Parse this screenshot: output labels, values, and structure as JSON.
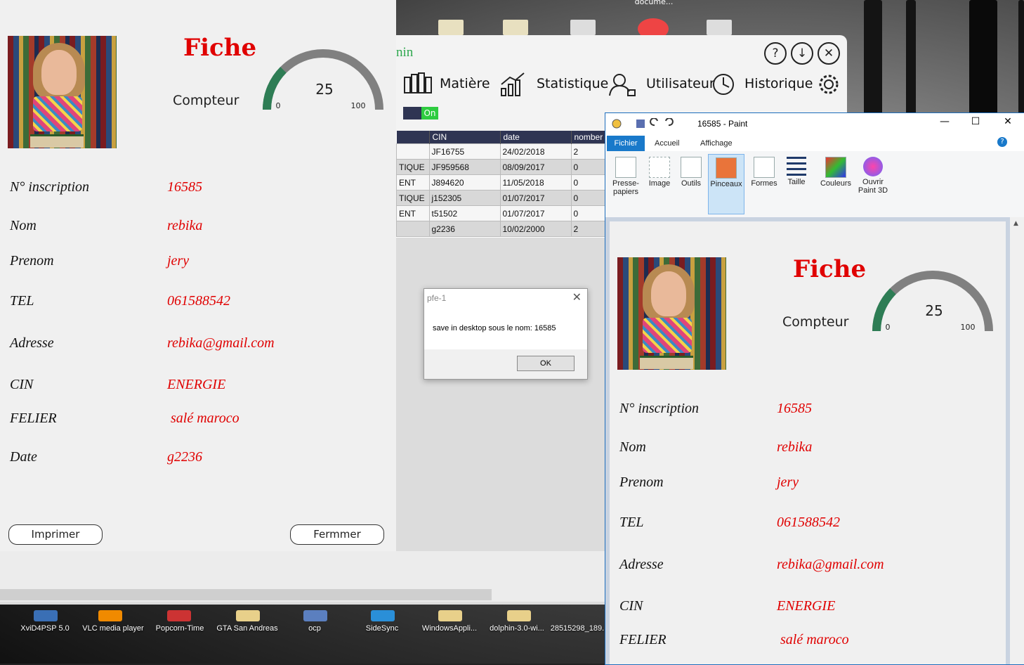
{
  "desktop": {
    "top_icon_label": "docume...",
    "taskbar_icons": [
      "XviD4PSP 5.0",
      "VLC media player",
      "Popcorn-Time",
      "GTA San Andreas",
      "ocp",
      "SideSync",
      "WindowsAppli...",
      "dolphin-3.0-wi...",
      "28515298_189..."
    ]
  },
  "admin_window": {
    "title_fragment": "nin",
    "header_buttons": [
      "?",
      "↓",
      "✕"
    ],
    "menu": [
      "Matière",
      "Statistique",
      "Utilisateur",
      "Historique"
    ],
    "toggle_label": "On",
    "table": {
      "columns": [
        "",
        "CIN",
        "date",
        "nomber"
      ],
      "rows": [
        [
          "",
          "JF16755",
          "24/02/2018",
          "2"
        ],
        [
          "TIQUE",
          "JF959568",
          "08/09/2017",
          "0"
        ],
        [
          "ENT",
          "J894620",
          "11/05/2018",
          "0"
        ],
        [
          "TIQUE",
          "j152305",
          "01/07/2017",
          "0"
        ],
        [
          "ENT",
          "t51502",
          "01/07/2017",
          "0"
        ],
        [
          "",
          "g2236",
          "10/02/2000",
          "2"
        ]
      ]
    }
  },
  "dialog": {
    "title": "pfe-1",
    "message": "save in desktop sous le nom:   16585",
    "ok": "OK",
    "close": "✕"
  },
  "fiche": {
    "title": "Fiche",
    "compteur_label": "Compteur",
    "gauge": {
      "value": 25,
      "min_label": "0",
      "max_label": "100",
      "fill_fraction": 0.25,
      "color_fill": "#2e7d55",
      "color_track": "#808080"
    },
    "fields": [
      {
        "label": "N° inscription",
        "value": "16585"
      },
      {
        "label": "Nom",
        "value": "rebika"
      },
      {
        "label": "Prenom",
        "value": "jery"
      },
      {
        "label": "TEL",
        "value": "061588542"
      },
      {
        "label": "Adresse",
        "value": "rebika@gmail.com"
      },
      {
        "label": "CIN",
        "value": "ENERGIE"
      },
      {
        "label": "FELIER",
        "value": " salé maroco"
      },
      {
        "label": "Date",
        "value": "g2236"
      }
    ],
    "buttons": {
      "print": "Imprimer",
      "close": "Fermmer"
    }
  },
  "paint": {
    "title": "16585 - Paint",
    "window_controls": [
      "—",
      "☐",
      "✕"
    ],
    "tabs": [
      "Fichier",
      "Accueil",
      "Affichage"
    ],
    "ribbon": [
      "Presse-\npapiers",
      "Image",
      "Outils",
      "Pinceaux",
      "Formes",
      "Taille",
      "Couleurs",
      "Ouvrir\nPaint 3D"
    ],
    "accent": "#1979ca"
  }
}
